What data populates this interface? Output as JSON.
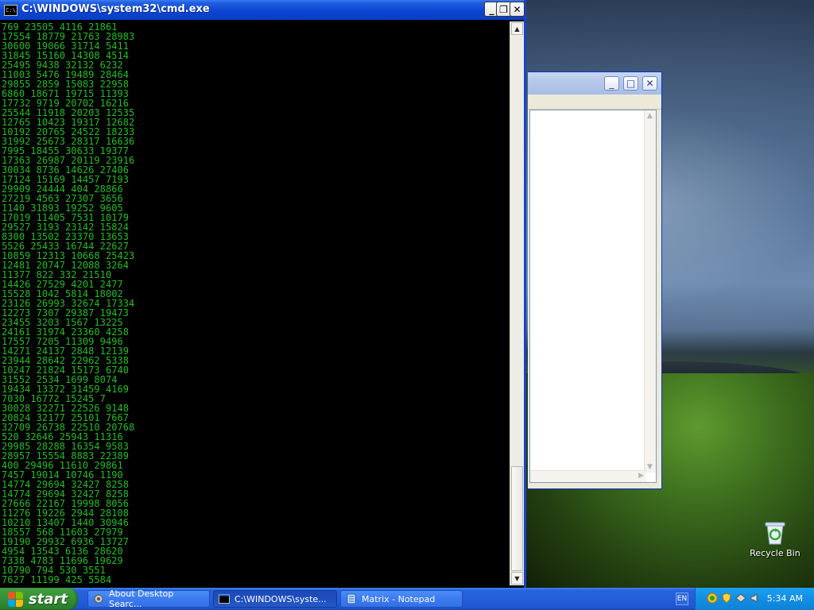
{
  "desktop": {
    "recycle_bin_label": "Recycle Bin"
  },
  "cmd_window": {
    "title": "C:\\WINDOWS\\system32\\cmd.exe",
    "icon_text": "C:\\",
    "lines": [
      "769 23505 4116 21861",
      "17554 18779 21763 28983",
      "30600 19066 31714 5411",
      "31845 15160 14308 4514",
      "25495 9438 32132 6232",
      "11003 5476 19489 28464",
      "29855 2859 15083 22958",
      "6860 18671 19715 11393",
      "17732 9719 20702 16216",
      "25544 11918 20203 12535",
      "12765 10423 19317 12682",
      "10192 20765 24522 18233",
      "31992 25673 28317 16636",
      "7995 18455 30633 19377",
      "17363 26987 20119 23916",
      "30034 8736 14626 27406",
      "17124 15169 14457 7193",
      "29909 24444 404 28866",
      "27219 4563 27307 3656",
      "1140 31893 19252 9605",
      "17019 11405 7531 10179",
      "29527 3193 23142 15824",
      "8300 13502 23370 13653",
      "5526 25433 16744 22627",
      "10859 12313 10668 25423",
      "12481 20747 12088 3264",
      "11377 822 332 21510",
      "14426 27529 4201 2477",
      "15528 1042 5814 18002",
      "23126 26993 32674 17334",
      "12273 7307 29387 19473",
      "23455 3203 1567 13225",
      "24161 31974 23360 4258",
      "17557 7205 11309 9496",
      "14271 24137 2848 12139",
      "23944 28642 22962 5338",
      "10247 21824 15173 6740",
      "31552 2534 1699 8074",
      "19434 13372 31459 4169",
      "7030 16772 15245 7",
      "30028 32271 22526 9148",
      "20824 32177 25101 7667",
      "32709 26738 22510 20768",
      "520 32646 25943 11316",
      "29985 28288 16354 9583",
      "28957 15554 8883 22389",
      "400 29496 11610 29861",
      "7457 19014 10746 1190",
      "14774 29694 32427 8258",
      "14774 29694 32427 8258",
      "27666 22167 19998 8056",
      "11276 19226 2944 28108",
      "10210 13407 1440 30946",
      "18557 568 11603 27979",
      "19190 29932 6936 13727",
      "4954 13543 6136 28620",
      "7338 4783 11696 19629",
      "10790 794 530 3551",
      "7627 11199 425 5584"
    ]
  },
  "taskbar": {
    "start_label": "start",
    "tasks": [
      {
        "label": "About Desktop Searc..."
      },
      {
        "label": "C:\\WINDOWS\\syste..."
      },
      {
        "label": "Matrix - Notepad"
      }
    ],
    "language": "EN",
    "clock": "5:34 AM"
  },
  "colors": {
    "console_text": "#1fbf1f",
    "titlebar_blue": "#0c45d3",
    "start_green": "#318b31"
  }
}
